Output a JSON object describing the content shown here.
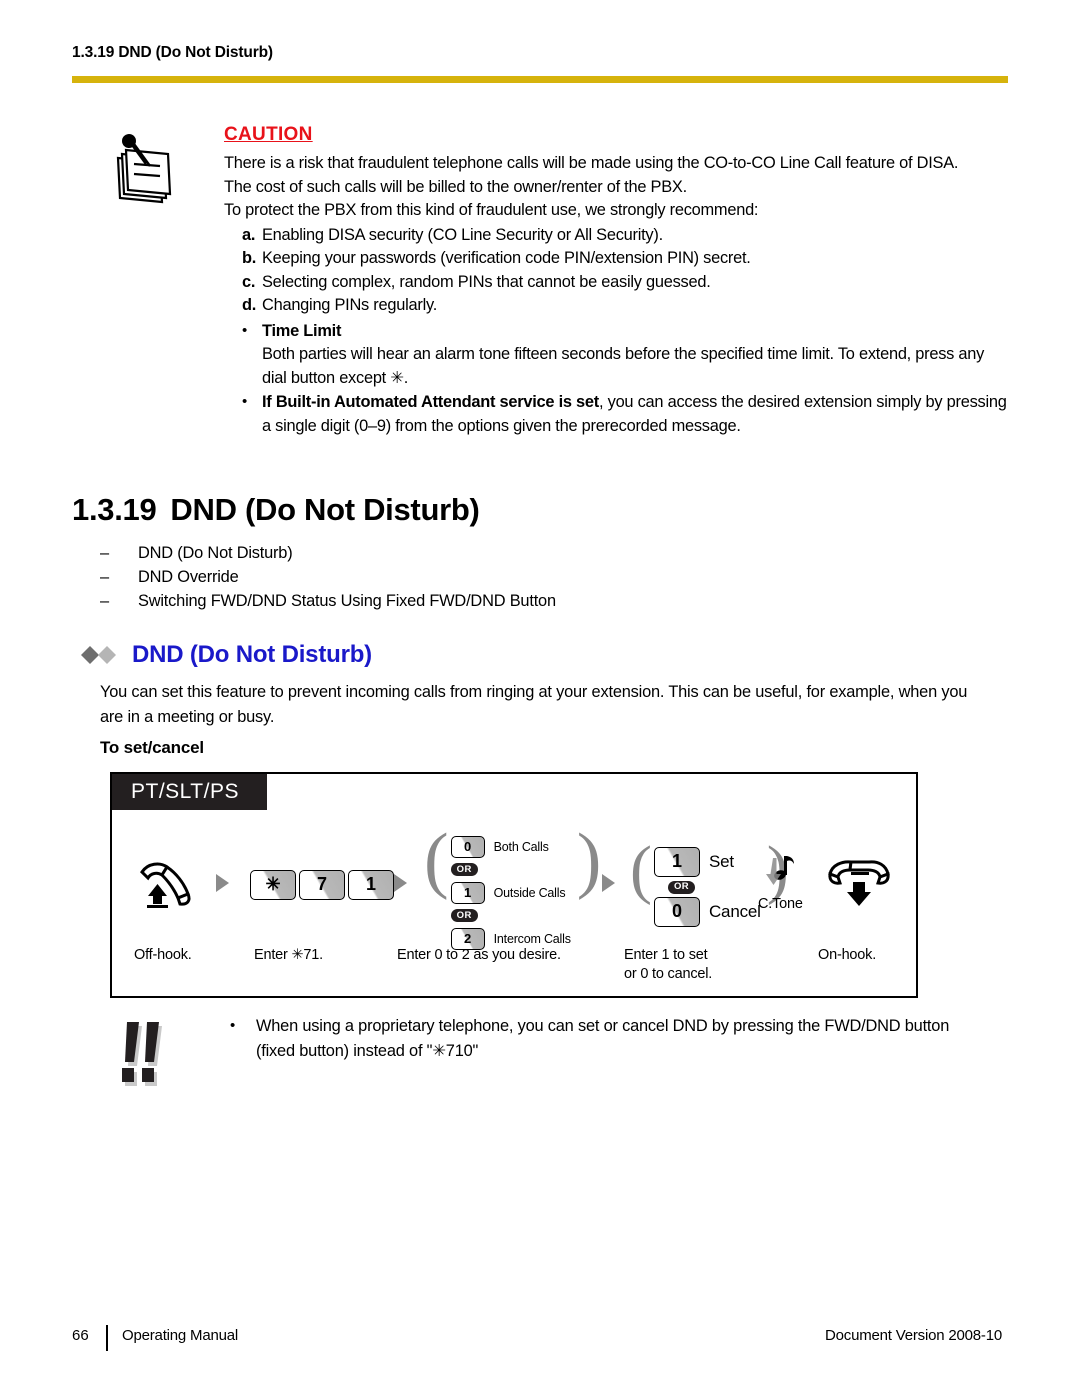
{
  "header": {
    "running_title": "1.3.19 DND (Do Not Disturb)",
    "rule_color": "#d6b30c"
  },
  "caution": {
    "icon": "notepad-pen-icon",
    "title": "CAUTION",
    "title_color": "#e8121a",
    "paragraphs": [
      "There is a risk that fraudulent telephone calls will be made using the CO-to-CO Line Call feature of DISA.",
      "The cost of such calls will be billed to the owner/renter of the PBX.",
      "To protect the PBX from this kind of fraudulent use, we strongly recommend:"
    ],
    "alpha_items": [
      {
        "marker": "a.",
        "text": "Enabling DISA security (CO Line Security or All Security)."
      },
      {
        "marker": "b.",
        "text": "Keeping your passwords (verification code PIN/extension PIN) secret."
      },
      {
        "marker": "c.",
        "text": "Selecting complex, random PINs that cannot be easily guessed."
      },
      {
        "marker": "d.",
        "text": "Changing PINs regularly."
      }
    ],
    "bullets": [
      {
        "bullet": "•",
        "bold_lead": "Time Limit",
        "body": "Both parties will hear an alarm tone fifteen seconds before the specified time limit. To extend, press any dial button except ✳."
      },
      {
        "bullet": "•",
        "bold_lead": "If Built-in Automated Attendant service is set",
        "body": ", you can access the desired extension simply by pressing a single digit (0–9) from the options given the prerecorded message."
      }
    ]
  },
  "chapter": {
    "number": "1.3.19",
    "title": "DND (Do Not Disturb)",
    "topics": [
      "DND (Do Not Disturb)",
      "DND Override",
      "Switching FWD/DND Status Using Fixed FWD/DND Button"
    ],
    "dash": "–"
  },
  "feature": {
    "diamond_dark": "#6e6e6e",
    "diamond_light": "#b5b5b5",
    "heading": "DND (Do Not Disturb)",
    "heading_color": "#1a19c9",
    "paragraph": "You can set this feature to prevent incoming calls from ringing at your extension. This can be useful, for example, when you are in a meeting or busy.",
    "subhead": "To set/cancel"
  },
  "procedure": {
    "tag": "PT/SLT/PS",
    "offhook_icon": "handset-offhook-icon",
    "onhook_icon": "handset-onhook-icon",
    "tone_icon": "confirmation-tone-icon",
    "tone_label": "C.Tone",
    "keys_dial": [
      "✳",
      "7",
      "1"
    ],
    "or_label": "OR",
    "options": [
      {
        "key": "0",
        "label": "Both Calls"
      },
      {
        "key": "1",
        "label": "Outside Calls"
      },
      {
        "key": "2",
        "label": "Intercom Calls"
      }
    ],
    "setcancel": [
      {
        "key": "1",
        "label": "Set"
      },
      {
        "key": "0",
        "label": "Cancel"
      }
    ],
    "captions": [
      "Off-hook.",
      "Enter ✳71.",
      "Enter 0 to 2 as you desire.",
      "Enter 1 to set\nor 0 to cancel.",
      "On-hook."
    ],
    "caption_set_line1": "Enter 1 to set",
    "caption_set_line2": "or 0 to cancel."
  },
  "note": {
    "icon": "double-exclamation-icon",
    "bullet": "•",
    "text": "When using a proprietary telephone, you can set or cancel DND by pressing the FWD/DND button (fixed button) instead of \"✳710\""
  },
  "footer": {
    "page_number": "66",
    "manual_name": "Operating Manual",
    "document_version": "Document Version  2008-10"
  }
}
